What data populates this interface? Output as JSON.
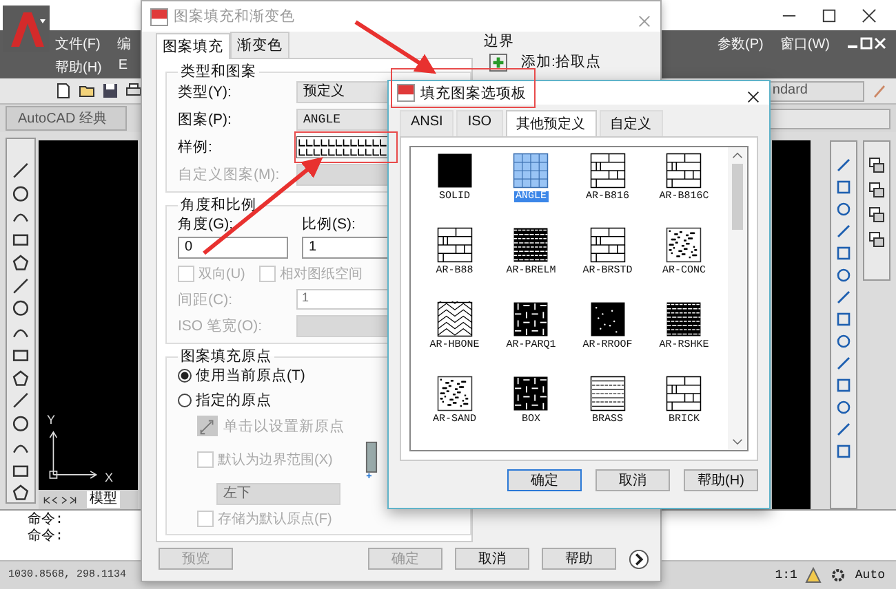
{
  "app": {
    "menu_rows": [
      [
        "文件(F)",
        "编"
      ],
      [
        "帮助(H)",
        "E"
      ]
    ],
    "menu_right": [
      "参数(P)",
      "窗口(W)"
    ],
    "workspace": "AutoCAD 经典",
    "style_field": "ndard",
    "ucs": {
      "x": "X",
      "y": "Y"
    },
    "model_tab": "模型",
    "commands": [
      "命令:",
      "命令:"
    ],
    "coordinates": "1030.8568, 298.1134",
    "scale": "1:1",
    "workspace_switch": "Auto"
  },
  "hatch_dialog": {
    "title": "图案填充和渐变色",
    "tabs": [
      {
        "label": "图案填充",
        "selected": true
      },
      {
        "label": "渐变色",
        "selected": false
      }
    ],
    "type_group": {
      "title": "类型和图案",
      "type_label": "类型(Y):",
      "type_value": "预定义",
      "pattern_label": "图案(P):",
      "pattern_value": "ANGLE",
      "sample_label": "样例:",
      "custom_label": "自定义图案(M):"
    },
    "angle_group": {
      "title": "角度和比例",
      "angle_label": "角度(G):",
      "angle_value": "0",
      "scale_label": "比例(S):",
      "scale_value": "1",
      "checks": [
        {
          "label": "双向(U)",
          "checked": false,
          "disabled": true
        },
        {
          "label": "相对图纸空间",
          "checked": false,
          "disabled": true
        }
      ],
      "spacing_label": "间距(C):",
      "spacing_value": "1",
      "pen_label": "ISO 笔宽(O):"
    },
    "origin_group": {
      "title": "图案填充原点",
      "radios": [
        {
          "label": "使用当前原点(T)",
          "selected": true
        },
        {
          "label": "指定的原点",
          "selected": false
        }
      ],
      "set_origin": "单击以设置新原点",
      "default_extent": {
        "label": "默认为边界范围(X)",
        "checked": false
      },
      "position": "左下",
      "store_default": {
        "label": "存储为默认原点(F)",
        "checked": false
      }
    },
    "boundary": {
      "title": "边界",
      "add_pick": "添加:拾取点"
    },
    "buttons": [
      {
        "label": "预览",
        "disabled": true
      },
      {
        "label": "确定",
        "disabled": true
      },
      {
        "label": "取消",
        "disabled": false
      },
      {
        "label": "帮助",
        "disabled": false
      }
    ]
  },
  "palette_dialog": {
    "title": "填充图案选项板",
    "tabs": [
      {
        "label": "ANSI",
        "selected": false
      },
      {
        "label": "ISO",
        "selected": false
      },
      {
        "label": "其他预定义",
        "selected": true
      },
      {
        "label": "自定义",
        "selected": false
      }
    ],
    "patterns": [
      {
        "name": "SOLID",
        "kind": "solid",
        "selected": false
      },
      {
        "name": "ANGLE",
        "kind": "grid",
        "selected": true
      },
      {
        "name": "AR-B816",
        "kind": "brick",
        "selected": false
      },
      {
        "name": "AR-B816C",
        "kind": "brick",
        "selected": false
      },
      {
        "name": "AR-B88",
        "kind": "brick",
        "selected": false
      },
      {
        "name": "AR-BRELM",
        "kind": "dense",
        "selected": false
      },
      {
        "name": "AR-BRSTD",
        "kind": "brick",
        "selected": false
      },
      {
        "name": "AR-CONC",
        "kind": "noise",
        "selected": false
      },
      {
        "name": "AR-HBONE",
        "kind": "herringbone",
        "selected": false
      },
      {
        "name": "AR-PARQ1",
        "kind": "parquet",
        "selected": false
      },
      {
        "name": "AR-RROOF",
        "kind": "dots",
        "selected": false
      },
      {
        "name": "AR-RSHKE",
        "kind": "dense",
        "selected": false
      },
      {
        "name": "AR-SAND",
        "kind": "noise",
        "selected": false
      },
      {
        "name": "BOX",
        "kind": "parquet",
        "selected": false
      },
      {
        "name": "BRASS",
        "kind": "lines",
        "selected": false
      },
      {
        "name": "BRICK",
        "kind": "brick",
        "selected": false
      }
    ],
    "buttons": [
      {
        "label": "确定",
        "focused": true
      },
      {
        "label": "取消",
        "focused": false
      },
      {
        "label": "帮助(H)",
        "focused": false
      }
    ]
  }
}
